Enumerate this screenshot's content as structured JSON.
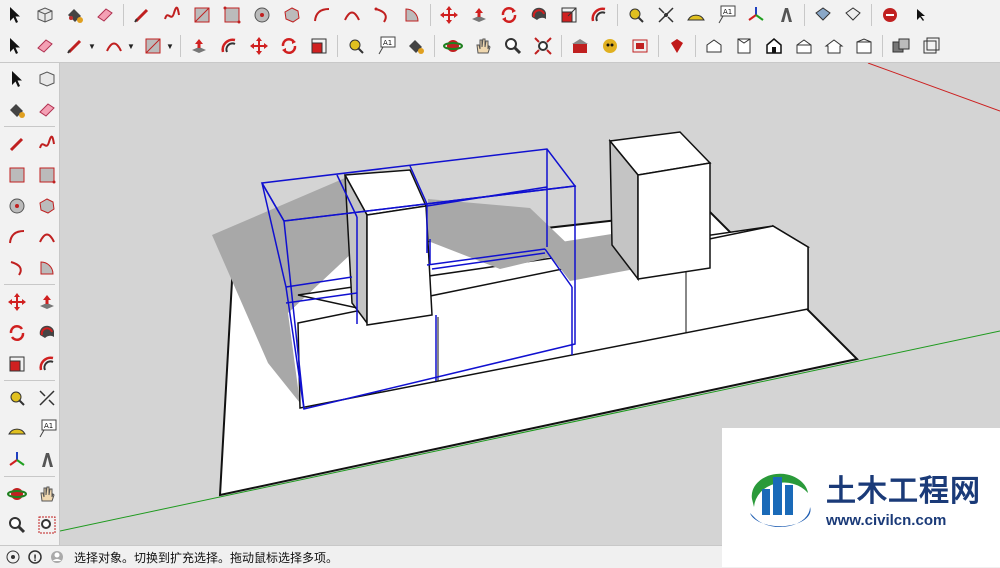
{
  "status_bar": {
    "message": "选择对象。切换到扩充选择。拖动鼠标选择多项。"
  },
  "watermark": {
    "name": "土木工程网",
    "url": "www.civilcn.com"
  },
  "icons": {
    "select": "arrow-cursor-icon",
    "eraser": "eraser-icon",
    "paint": "paint-bucket-icon",
    "pencil": "pencil-icon",
    "move": "move-icon",
    "rotate": "rotate-icon",
    "text_label": "A1"
  },
  "colors": {
    "selection": "#1010d0",
    "red_axis": "#cc2020",
    "green_axis": "#1e9a1e",
    "toolbar_bg": "#f2f2f2",
    "ground": "#ffffff",
    "wall_shadow": "#a8a8a8"
  }
}
